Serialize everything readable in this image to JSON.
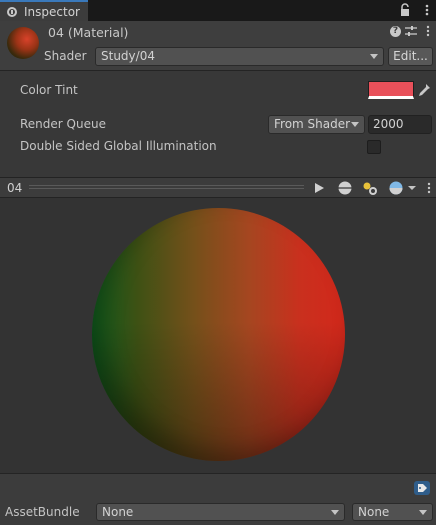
{
  "window": {
    "tab_label": "Inspector",
    "icons": [
      "inspector-icon",
      "lock-icon",
      "menu-icon"
    ]
  },
  "header": {
    "material_name": "04 (Material)",
    "shader_label": "Shader",
    "shader_value": "Study/04",
    "edit_label": "Edit...",
    "icons": [
      "help-icon",
      "settings-icon",
      "menu-icon"
    ]
  },
  "properties": {
    "color_tint_label": "Color Tint",
    "color_tint_value": "#e8505a",
    "render_queue_label": "Render Queue",
    "render_queue_mode": "From Shader",
    "render_queue_value": "2000",
    "dsgi_label": "Double Sided Global Illumination",
    "dsgi_checked": false
  },
  "preview": {
    "title": "04",
    "buttons": [
      "play-icon",
      "sphere-mesh-icon",
      "light-icon",
      "background-icon",
      "menu-icon"
    ]
  },
  "footer": {
    "assetbundle_label": "AssetBundle",
    "bundle_name": "None",
    "bundle_variant": "None"
  },
  "colors": {
    "accent": "#3a79bb",
    "panel_bg": "#383838",
    "toolbar_bg": "#3c3c3c",
    "field_bg": "#2a2a2a"
  }
}
